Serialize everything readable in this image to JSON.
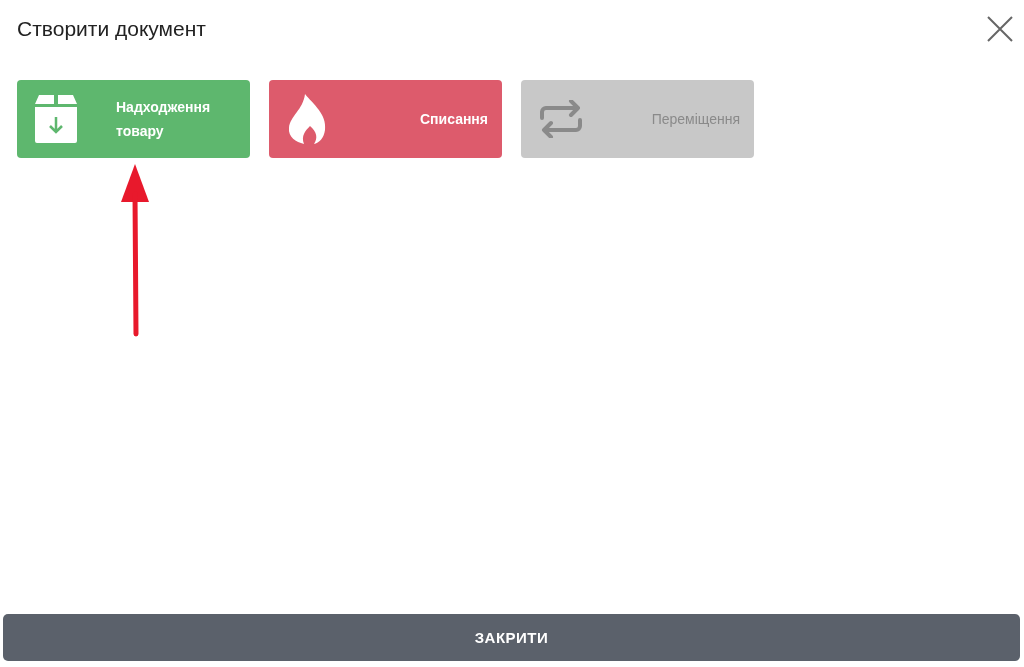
{
  "dialog": {
    "title": "Створити документ"
  },
  "document_types": [
    {
      "kind": "box",
      "label": "Надходження товару",
      "color": "#5eb76e",
      "disabled": false
    },
    {
      "kind": "flame",
      "label": "Списання",
      "color": "#dd5b6c",
      "disabled": false
    },
    {
      "kind": "swap",
      "label": "Переміщення",
      "color": "#c8c8c8",
      "disabled": true
    }
  ],
  "close_button": {
    "label": "ЗАКРИТИ"
  }
}
